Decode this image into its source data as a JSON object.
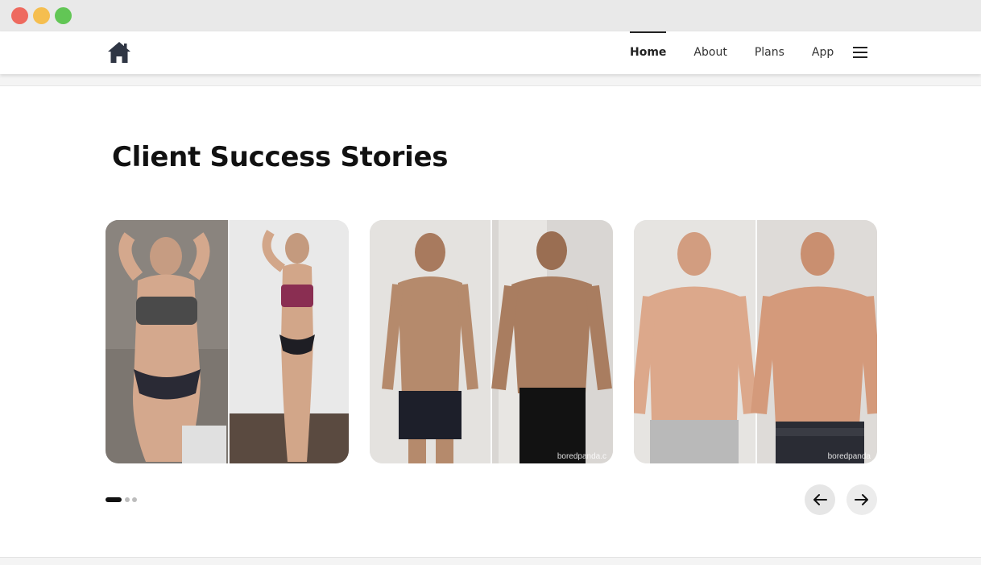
{
  "nav": {
    "links": [
      "Home",
      "About",
      "Plans",
      "App"
    ],
    "active_index": 0
  },
  "section": {
    "title": "Client Success Stories"
  },
  "cards": [
    {
      "watermark": ""
    },
    {
      "watermark": "boredpanda.c"
    },
    {
      "watermark": "boredpanda"
    }
  ],
  "carousel": {
    "pages": 3,
    "active_page": 1
  },
  "colors": {
    "nav_text": "#333333",
    "title": "#111111",
    "arrow_bg": "#e6e6e6"
  },
  "icons": {
    "logo": "home-icon",
    "menu": "hamburger-menu-icon",
    "prev": "arrow-left-icon",
    "next": "arrow-right-icon"
  }
}
